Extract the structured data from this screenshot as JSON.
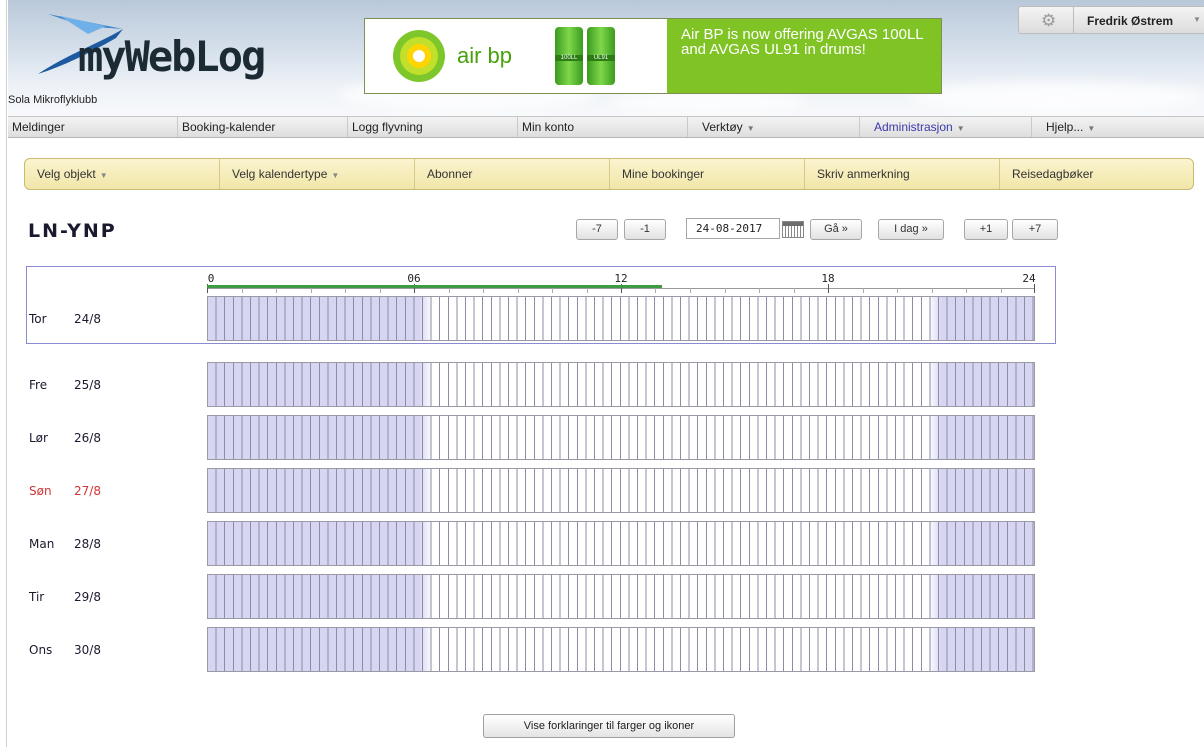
{
  "header": {
    "club_name": "Sola Mikroflyklubb",
    "logo_text": "myWebLog",
    "ad": {
      "brand": "air bp",
      "drum_labels": [
        "100LL",
        "UL91"
      ],
      "message": "Air BP is now offering AVGAS 100LL and AVGAS UL91 in drums!"
    },
    "user": {
      "name": "Fredrik Østrem"
    }
  },
  "menu": [
    {
      "label": "Meldinger",
      "has_arrow": false
    },
    {
      "label": "Booking-kalender",
      "has_arrow": false
    },
    {
      "label": "Logg flyvning",
      "has_arrow": false
    },
    {
      "label": "Min konto",
      "has_arrow": false
    },
    {
      "label": "Verktøy",
      "has_arrow": true
    },
    {
      "label": "Administrasjon",
      "has_arrow": true
    },
    {
      "label": "Hjelp...",
      "has_arrow": true
    }
  ],
  "submenu": [
    {
      "label": "Velg objekt",
      "has_arrow": true
    },
    {
      "label": "Velg kalendertype",
      "has_arrow": true
    },
    {
      "label": "Abonner",
      "has_arrow": false
    },
    {
      "label": "Mine bookinger",
      "has_arrow": false
    },
    {
      "label": "Skriv anmerkning",
      "has_arrow": false
    },
    {
      "label": "Reisedagbøker",
      "has_arrow": false
    }
  ],
  "page_title": "LN-YNP",
  "nav": {
    "minus7": "-7",
    "minus1": "-1",
    "date": "24-08-2017",
    "go": "Gå »",
    "today": "I dag »",
    "plus1": "+1",
    "plus7": "+7"
  },
  "axis_labels": [
    "0",
    "06",
    "12",
    "18",
    "24"
  ],
  "current_time_fraction": 0.55,
  "days": [
    {
      "weekday": "Tor",
      "date": "24/8",
      "is_today": true,
      "is_sunday": false
    },
    {
      "weekday": "Fre",
      "date": "25/8",
      "is_today": false,
      "is_sunday": false
    },
    {
      "weekday": "Lør",
      "date": "26/8",
      "is_today": false,
      "is_sunday": false
    },
    {
      "weekday": "Søn",
      "date": "27/8",
      "is_today": false,
      "is_sunday": true
    },
    {
      "weekday": "Man",
      "date": "28/8",
      "is_today": false,
      "is_sunday": false
    },
    {
      "weekday": "Tir",
      "date": "29/8",
      "is_today": false,
      "is_sunday": false
    },
    {
      "weekday": "Ons",
      "date": "30/8",
      "is_today": false,
      "is_sunday": false
    }
  ],
  "legend_button": "Vise forklaringer til farger og ikoner",
  "colors": {
    "night": "#d6d6f3",
    "day": "#ffffff",
    "sunday": "#d23636",
    "progress": "#3f9a44"
  }
}
